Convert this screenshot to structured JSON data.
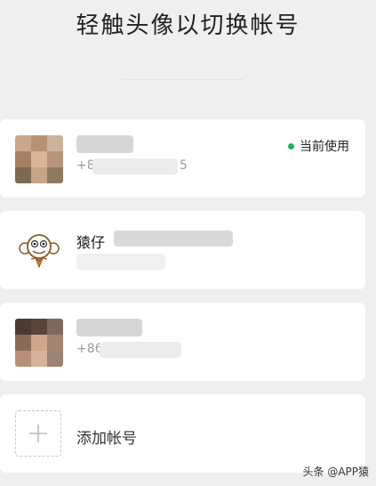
{
  "header": {
    "title": "轻触头像以切换帐号"
  },
  "accounts": [
    {
      "name": "",
      "phone_prefix": "+8",
      "phone_suffix": "5",
      "status": "当前使用",
      "status_color": "#15b36b"
    },
    {
      "name": "猿仔",
      "phone_prefix": "",
      "phone_suffix": "",
      "status": ""
    },
    {
      "name": "",
      "phone_prefix": "+86",
      "phone_suffix": "",
      "status": ""
    }
  ],
  "add_account": {
    "label": "添加帐号",
    "icon": "plus-icon"
  },
  "watermark": "头条 @APP猿",
  "colors": {
    "background": "#efeff0",
    "card": "#ffffff",
    "accent_green": "#15b36b"
  }
}
